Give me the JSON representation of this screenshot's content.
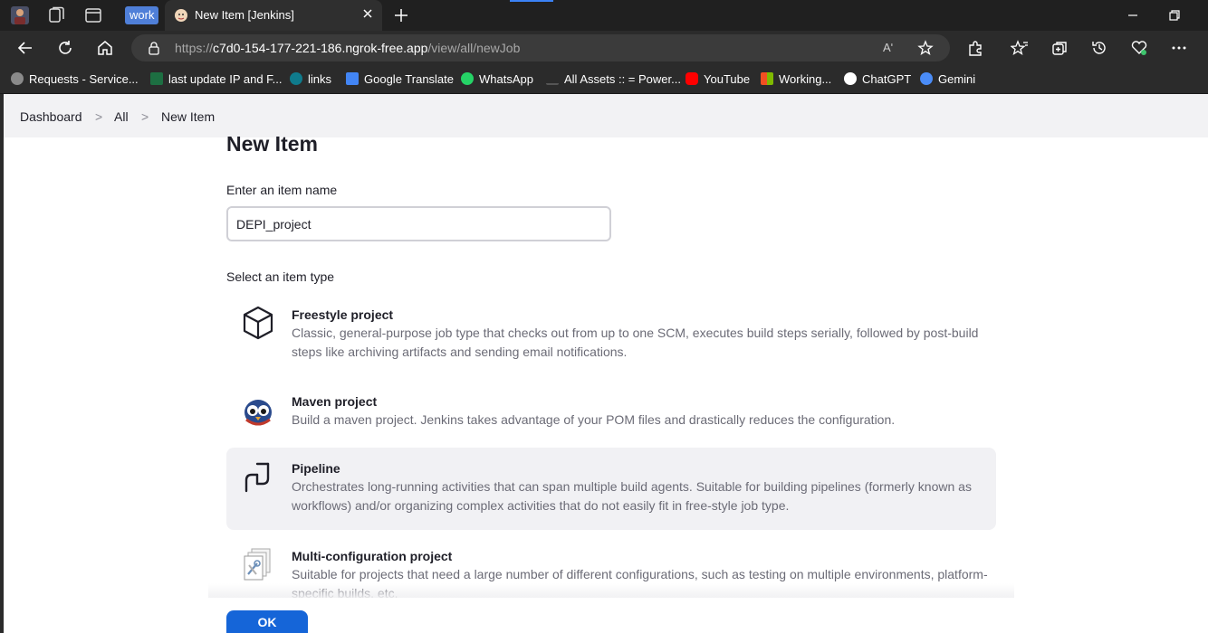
{
  "browser": {
    "workspace_label": "work",
    "tab_title": "New Item [Jenkins]",
    "url_prefix": "https://",
    "url_host": "c7d0-154-177-221-186.ngrok-free.app",
    "url_path": "/view/all/newJob",
    "read_aloud_label": "Aʹ",
    "bookmarks": [
      {
        "label": "Requests - Service...",
        "icon": "person-circle-icon",
        "color": "#8a8a8a"
      },
      {
        "label": "last update IP and F...",
        "icon": "excel-icon",
        "color": "#1d6f42"
      },
      {
        "label": "links",
        "icon": "sharepoint-icon",
        "color": "#0f7b8c"
      },
      {
        "label": "Google Translate",
        "icon": "google-translate-icon",
        "color": "#4285f4"
      },
      {
        "label": "WhatsApp",
        "icon": "whatsapp-icon",
        "color": "#25d366"
      },
      {
        "label": "All Assets :: = Power...",
        "icon": "dash-icon",
        "color": "#555555"
      },
      {
        "label": "YouTube",
        "icon": "youtube-icon",
        "color": "#ff0000"
      },
      {
        "label": "Working...",
        "icon": "microsoft-icon",
        "color": "#f25022"
      },
      {
        "label": "ChatGPT",
        "icon": "chatgpt-icon",
        "color": "#ffffff"
      },
      {
        "label": "Gemini",
        "icon": "gemini-icon",
        "color": "#4a8cf7"
      }
    ]
  },
  "breadcrumb": {
    "items": [
      "Dashboard",
      "All",
      "New Item"
    ],
    "separator": ">"
  },
  "main": {
    "title": "New Item",
    "name_label": "Enter an item name",
    "name_value": "DEPI_project",
    "type_label": "Select an item type",
    "item_types": [
      {
        "name": "Freestyle project",
        "description": "Classic, general-purpose job type that checks out from up to one SCM, executes build steps serially, followed by post-build steps like archiving artifacts and sending email notifications.",
        "icon": "cube-icon",
        "selected": false
      },
      {
        "name": "Maven project",
        "description": "Build a maven project. Jenkins takes advantage of your POM files and drastically reduces the configuration.",
        "icon": "maven-owl-icon",
        "selected": false
      },
      {
        "name": "Pipeline",
        "description": "Orchestrates long-running activities that can span multiple build agents. Suitable for building pipelines (formerly known as workflows) and/or organizing complex activities that do not easily fit in free-style job type.",
        "icon": "pipeline-icon",
        "selected": true
      },
      {
        "name": "Multi-configuration project",
        "description": "Suitable for projects that need a large number of different configurations, such as testing on multiple environments, platform-specific builds, etc.",
        "icon": "multi-config-icon",
        "selected": false
      }
    ],
    "ok_label": "OK"
  },
  "colors": {
    "accent": "#1565d8",
    "selected_background": "#f1f1f4",
    "browser_dark": "#202020"
  }
}
